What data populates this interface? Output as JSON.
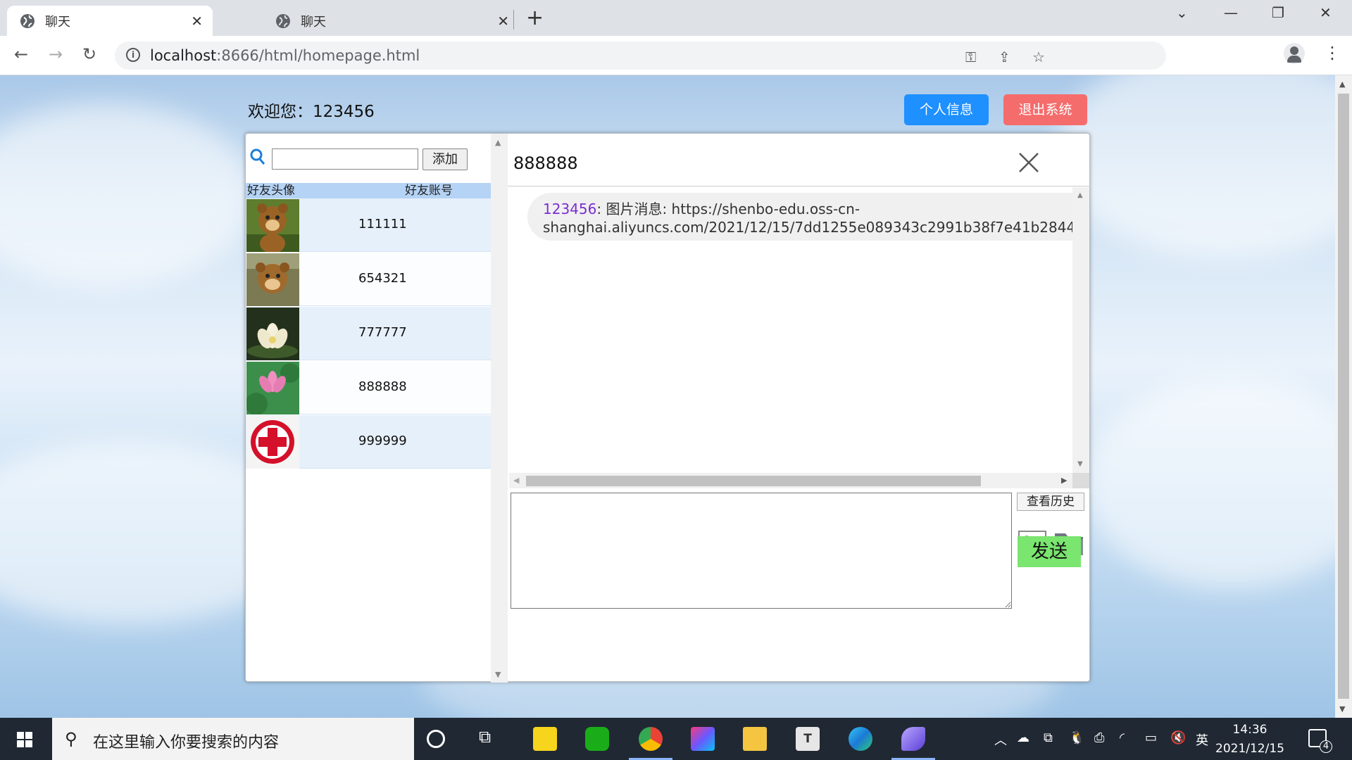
{
  "browser": {
    "tabs": [
      {
        "title": "聊天",
        "active": true
      },
      {
        "title": "聊天",
        "active": false
      }
    ],
    "url_host": "localhost",
    "url_rest": ":8666/html/homepage.html"
  },
  "page": {
    "welcome": "欢迎您：123456",
    "profile_button": "个人信息",
    "logout_button": "退出系统"
  },
  "friends": {
    "add_input_value": "",
    "add_button": "添加",
    "header_avatar": "好友头像",
    "header_account": "好友账号",
    "list": [
      {
        "account": "111111",
        "avatar": "bear-avatar"
      },
      {
        "account": "654321",
        "avatar": "bear-avatar"
      },
      {
        "account": "777777",
        "avatar": "lotus-white-avatar"
      },
      {
        "account": "888888",
        "avatar": "lotus-pink-avatar"
      },
      {
        "account": "999999",
        "avatar": "red-cross-avatar"
      }
    ]
  },
  "chat": {
    "partner": "888888",
    "messages": [
      {
        "sender": "123456",
        "text_line1": ": 图片消息: https://shenbo-edu.oss-cn-",
        "text_line2": "shanghai.aliyuncs.com/2021/12/15/7dd1255e089343c2991b38f7e41b2844"
      }
    ],
    "compose_value": "",
    "history_button": "查看历史",
    "send_button": "发送"
  },
  "taskbar": {
    "search_placeholder": "在这里输入你要搜索的内容",
    "ime": "英",
    "time": "14:36",
    "date": "2021/12/15",
    "notifications": "4"
  },
  "colors": {
    "profile_button": "#1e90ff",
    "logout_button": "#f56c6c",
    "send_button": "#7ae56f",
    "friend_header": "#b5d3f5",
    "sender_name": "#7b2fd0"
  }
}
